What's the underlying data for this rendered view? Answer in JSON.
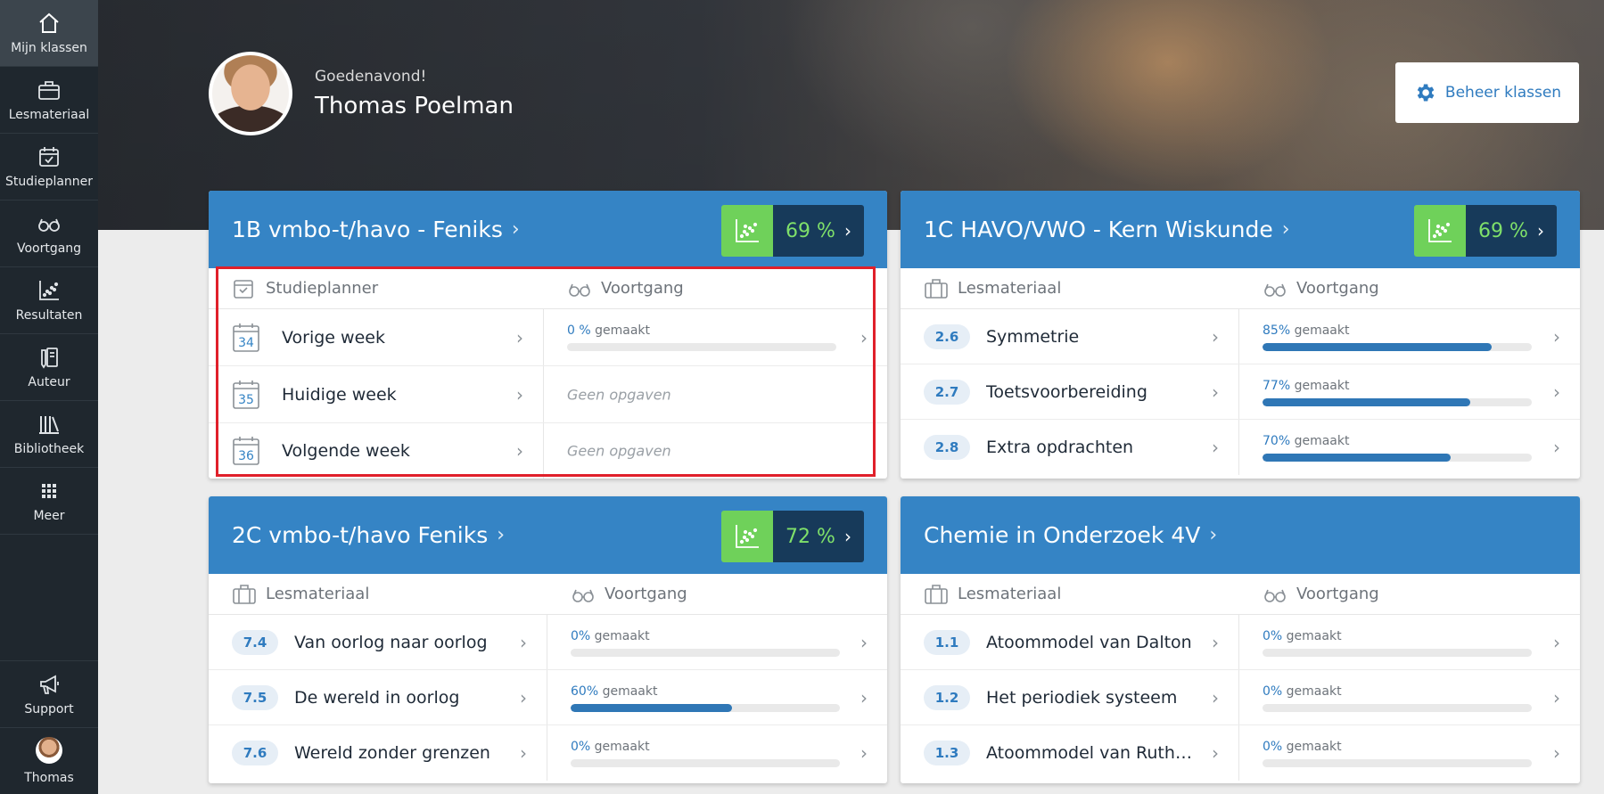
{
  "sidebar": {
    "items": [
      {
        "label": "Mijn klassen",
        "icon": "home-icon",
        "active": true
      },
      {
        "label": "Lesmateriaal",
        "icon": "briefcase-icon"
      },
      {
        "label": "Studieplanner",
        "icon": "calendar-check-icon"
      },
      {
        "label": "Voortgang",
        "icon": "glasses-icon"
      },
      {
        "label": "Resultaten",
        "icon": "scatter-chart-icon"
      },
      {
        "label": "Auteur",
        "icon": "pencil-book-icon"
      },
      {
        "label": "Bibliotheek",
        "icon": "books-icon"
      },
      {
        "label": "Meer",
        "icon": "grid-icon"
      }
    ],
    "bottom": [
      {
        "label": "Support",
        "icon": "megaphone-icon"
      },
      {
        "label": "Thomas",
        "icon": "avatar"
      }
    ]
  },
  "header": {
    "greeting": "Goedenavond!",
    "name": "Thomas Poelman",
    "manage_label": "Beheer klassen"
  },
  "colors": {
    "accent": "#3584c5",
    "score_green": "#6fd15a",
    "score_dark": "#173a5a",
    "highlight": "#e0202a"
  },
  "cards": [
    {
      "title": "1B vmbo-t/havo - Feniks",
      "score": "69 %",
      "left_header": "Studieplanner",
      "right_header": "Voortgang",
      "rows": [
        {
          "week": "34",
          "title": "Vorige week",
          "pct": "0 %",
          "suffix": "gemaakt",
          "progress": 0
        },
        {
          "week": "35",
          "title": "Huidige week",
          "empty": "Geen opgaven"
        },
        {
          "week": "36",
          "title": "Volgende week",
          "empty": "Geen opgaven"
        }
      ]
    },
    {
      "title": "1C HAVO/VWO - Kern Wiskunde",
      "score": "69 %",
      "left_header": "Lesmateriaal",
      "right_header": "Voortgang",
      "rows": [
        {
          "badge": "2.6",
          "title": "Symmetrie",
          "pct": "85%",
          "suffix": "gemaakt",
          "progress": 0.85
        },
        {
          "badge": "2.7",
          "title": "Toetsvoorbereiding",
          "pct": "77%",
          "suffix": "gemaakt",
          "progress": 0.77
        },
        {
          "badge": "2.8",
          "title": "Extra opdrachten",
          "pct": "70%",
          "suffix": "gemaakt",
          "progress": 0.7
        }
      ]
    },
    {
      "title": "2C vmbo-t/havo Feniks",
      "score": "72 %",
      "left_header": "Lesmateriaal",
      "right_header": "Voortgang",
      "rows": [
        {
          "badge": "7.4",
          "title": "Van oorlog naar oorlog",
          "pct": "0%",
          "suffix": "gemaakt",
          "progress": 0
        },
        {
          "badge": "7.5",
          "title": "De wereld in oorlog",
          "pct": "60%",
          "suffix": "gemaakt",
          "progress": 0.6
        },
        {
          "badge": "7.6",
          "title": "Wereld zonder grenzen",
          "pct": "0%",
          "suffix": "gemaakt",
          "progress": 0
        }
      ]
    },
    {
      "title": "Chemie in Onderzoek 4V",
      "left_header": "Lesmateriaal",
      "right_header": "Voortgang",
      "rows": [
        {
          "badge": "1.1",
          "title": "Atoommodel van Dalton",
          "pct": "0%",
          "suffix": "gemaakt",
          "progress": 0
        },
        {
          "badge": "1.2",
          "title": "Het periodiek systeem",
          "pct": "0%",
          "suffix": "gemaakt",
          "progress": 0
        },
        {
          "badge": "1.3",
          "title": "Atoommodel van Ruthe…",
          "pct": "0%",
          "suffix": "gemaakt",
          "progress": 0
        }
      ]
    }
  ]
}
